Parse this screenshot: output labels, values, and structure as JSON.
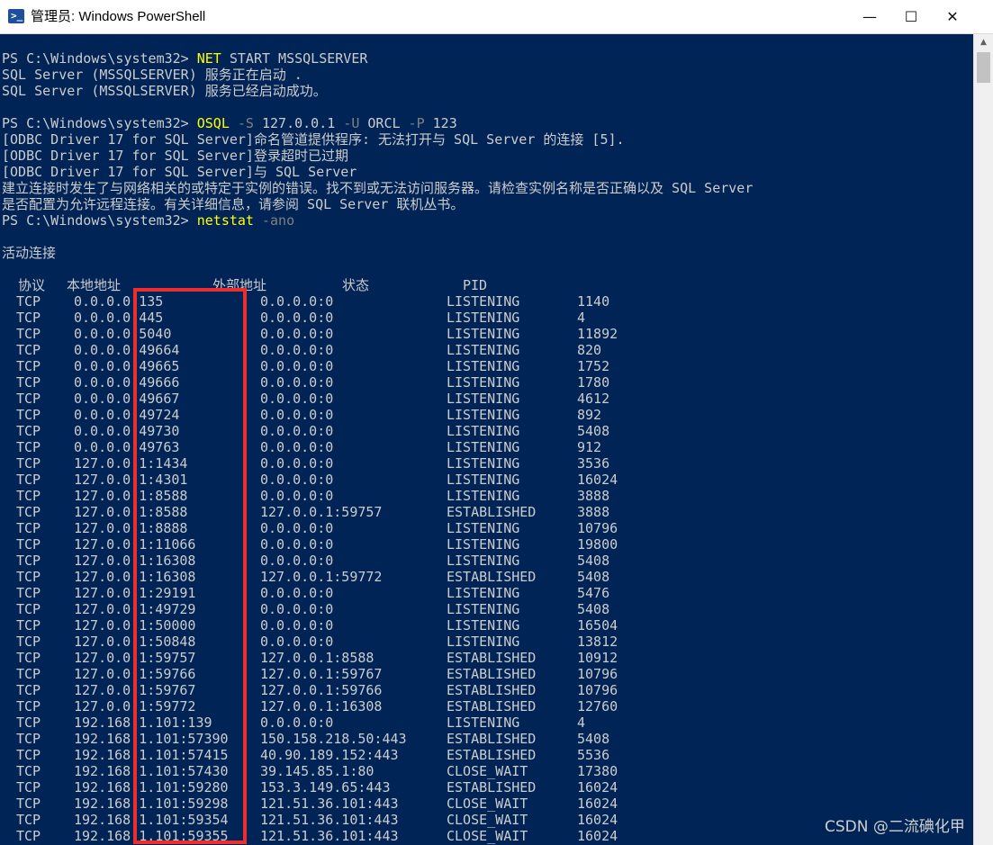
{
  "window": {
    "title": "管理员: Windows PowerShell",
    "minimize_glyph": "—",
    "maximize_glyph": "☐",
    "close_glyph": "✕",
    "icon": "powershell-icon"
  },
  "console": {
    "background": "#012456",
    "text_color": "#cccccc",
    "command_color": "#ffff00",
    "param_color": "#808080",
    "prompt": "PS C:\\Windows\\system32> ",
    "cmd1": {
      "name": "NET",
      "args": " START MSSQLSERVER"
    },
    "out1": [
      "SQL Server (MSSQLSERVER) 服务正在启动 .",
      "SQL Server (MSSQLSERVER) 服务已经启动成功。"
    ],
    "cmd2": {
      "name": "OSQL",
      "s_flag": " -S",
      "s_val": " 127.0.0.1",
      "u_flag": " -U",
      "u_val": " ORCL",
      "p_flag": " -P",
      "p_val": " 123"
    },
    "out2": [
      "[ODBC Driver 17 for SQL Server]命名管道提供程序: 无法打开与 SQL Server 的连接 [5].",
      "[ODBC Driver 17 for SQL Server]登录超时已过期",
      "[ODBC Driver 17 for SQL Server]与 SQL Server",
      "建立连接时发生了与网络相关的或特定于实例的错误。找不到或无法访问服务器。请检查实例名称是否正确以及 SQL Server",
      "是否配置为允许远程连接。有关详细信息，请参阅 SQL Server 联机丛书。"
    ],
    "cmd3": {
      "name": "netstat",
      "args": " -ano"
    },
    "section_title": "活动连接",
    "headers": {
      "proto": "协议",
      "local": "本地地址",
      "foreign": "外部地址",
      "state": "状态",
      "pid": "PID"
    },
    "rows": [
      [
        "TCP",
        "0.0.0.0:135",
        "0.0.0.0:0",
        "LISTENING",
        "1140"
      ],
      [
        "TCP",
        "0.0.0.0:445",
        "0.0.0.0:0",
        "LISTENING",
        "4"
      ],
      [
        "TCP",
        "0.0.0.0:5040",
        "0.0.0.0:0",
        "LISTENING",
        "11892"
      ],
      [
        "TCP",
        "0.0.0.0:49664",
        "0.0.0.0:0",
        "LISTENING",
        "820"
      ],
      [
        "TCP",
        "0.0.0.0:49665",
        "0.0.0.0:0",
        "LISTENING",
        "1752"
      ],
      [
        "TCP",
        "0.0.0.0:49666",
        "0.0.0.0:0",
        "LISTENING",
        "1780"
      ],
      [
        "TCP",
        "0.0.0.0:49667",
        "0.0.0.0:0",
        "LISTENING",
        "4612"
      ],
      [
        "TCP",
        "0.0.0.0:49724",
        "0.0.0.0:0",
        "LISTENING",
        "892"
      ],
      [
        "TCP",
        "0.0.0.0:49730",
        "0.0.0.0:0",
        "LISTENING",
        "5408"
      ],
      [
        "TCP",
        "0.0.0.0:49763",
        "0.0.0.0:0",
        "LISTENING",
        "912"
      ],
      [
        "TCP",
        "127.0.0.1:1434",
        "0.0.0.0:0",
        "LISTENING",
        "3536"
      ],
      [
        "TCP",
        "127.0.0.1:4301",
        "0.0.0.0:0",
        "LISTENING",
        "16024"
      ],
      [
        "TCP",
        "127.0.0.1:8588",
        "0.0.0.0:0",
        "LISTENING",
        "3888"
      ],
      [
        "TCP",
        "127.0.0.1:8588",
        "127.0.0.1:59757",
        "ESTABLISHED",
        "3888"
      ],
      [
        "TCP",
        "127.0.0.1:8888",
        "0.0.0.0:0",
        "LISTENING",
        "10796"
      ],
      [
        "TCP",
        "127.0.0.1:11066",
        "0.0.0.0:0",
        "LISTENING",
        "19800"
      ],
      [
        "TCP",
        "127.0.0.1:16308",
        "0.0.0.0:0",
        "LISTENING",
        "5408"
      ],
      [
        "TCP",
        "127.0.0.1:16308",
        "127.0.0.1:59772",
        "ESTABLISHED",
        "5408"
      ],
      [
        "TCP",
        "127.0.0.1:29191",
        "0.0.0.0:0",
        "LISTENING",
        "5476"
      ],
      [
        "TCP",
        "127.0.0.1:49729",
        "0.0.0.0:0",
        "LISTENING",
        "5408"
      ],
      [
        "TCP",
        "127.0.0.1:50000",
        "0.0.0.0:0",
        "LISTENING",
        "16504"
      ],
      [
        "TCP",
        "127.0.0.1:50848",
        "0.0.0.0:0",
        "LISTENING",
        "13812"
      ],
      [
        "TCP",
        "127.0.0.1:59757",
        "127.0.0.1:8588",
        "ESTABLISHED",
        "10912"
      ],
      [
        "TCP",
        "127.0.0.1:59766",
        "127.0.0.1:59767",
        "ESTABLISHED",
        "10796"
      ],
      [
        "TCP",
        "127.0.0.1:59767",
        "127.0.0.1:59766",
        "ESTABLISHED",
        "10796"
      ],
      [
        "TCP",
        "127.0.0.1:59772",
        "127.0.0.1:16308",
        "ESTABLISHED",
        "12760"
      ],
      [
        "TCP",
        "192.168.1.101:139",
        "0.0.0.0:0",
        "LISTENING",
        "4"
      ],
      [
        "TCP",
        "192.168.1.101:57390",
        "150.158.218.50:443",
        "ESTABLISHED",
        "5408"
      ],
      [
        "TCP",
        "192.168.1.101:57415",
        "40.90.189.152:443",
        "ESTABLISHED",
        "5536"
      ],
      [
        "TCP",
        "192.168.1.101:57430",
        "39.145.85.1:80",
        "CLOSE_WAIT",
        "17380"
      ],
      [
        "TCP",
        "192.168.1.101:59280",
        "153.3.149.65:443",
        "ESTABLISHED",
        "16024"
      ],
      [
        "TCP",
        "192.168.1.101:59298",
        "121.51.36.101:443",
        "CLOSE_WAIT",
        "16024"
      ],
      [
        "TCP",
        "192.168.1.101:59354",
        "121.51.36.101:443",
        "CLOSE_WAIT",
        "16024"
      ],
      [
        "TCP",
        "192.168.1.101:59355",
        "121.51.36.101:443",
        "CLOSE_WAIT",
        "16024"
      ]
    ]
  },
  "annotation": {
    "color": "#ee2d2d"
  },
  "watermark": "CSDN @二流碘化甲"
}
